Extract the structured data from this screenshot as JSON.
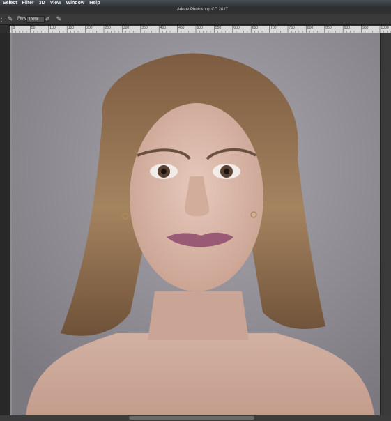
{
  "menubar": {
    "items": [
      "Select",
      "Filter",
      "3D",
      "View",
      "Window",
      "Help"
    ]
  },
  "app": {
    "title": "Adobe Photoshop CC 2017"
  },
  "options": {
    "flow_label": "Flow:",
    "flow_value": "100%"
  },
  "ruler": {
    "ticks": [
      "0",
      "50",
      "100",
      "150",
      "200",
      "250",
      "300",
      "350",
      "400",
      "450",
      "500",
      "550",
      "600",
      "650",
      "700",
      "750",
      "800",
      "850",
      "900",
      "950",
      "1000"
    ]
  },
  "icons": {
    "tool_preset": "brush-icon",
    "airbrush": "airbrush-icon",
    "pressure": "pressure-icon"
  },
  "colors": {
    "menubar": "#3a3e45",
    "background": "#282828",
    "canvas_backdrop": "#8e8b93",
    "skin": "#d9b8aa",
    "hair": "#8a6a4c",
    "lips": "#9a5a75"
  }
}
